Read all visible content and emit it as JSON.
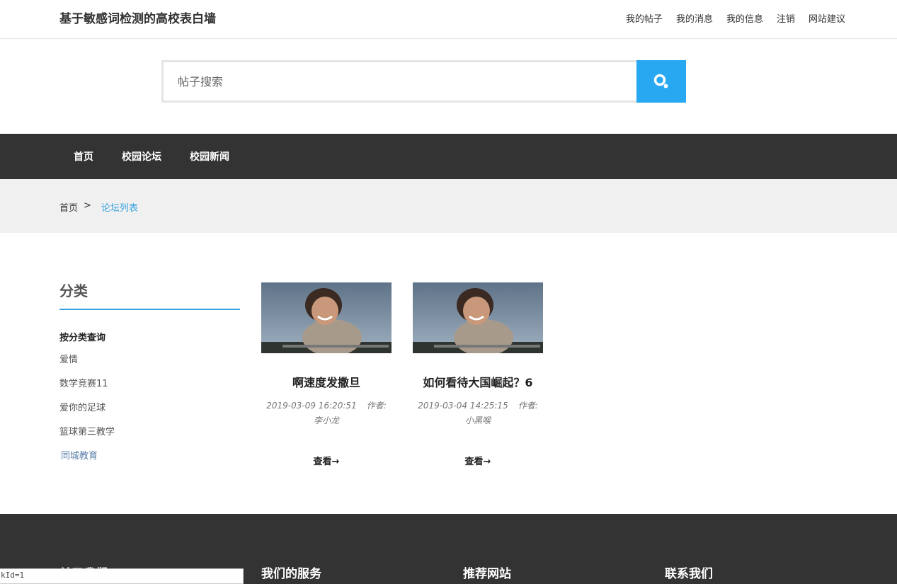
{
  "header": {
    "site_title": "基于敏感词检测的高校表白墙",
    "nav": [
      "我的帖子",
      "我的消息",
      "我的信息",
      "注销",
      "网站建议"
    ]
  },
  "search": {
    "placeholder": "帖子搜索",
    "value": "",
    "button_icon": "search-icon"
  },
  "main_nav": [
    "首页",
    "校园论坛",
    "校园新闻"
  ],
  "breadcrumb": {
    "home": "首页",
    "separator": ">",
    "current": "论坛列表"
  },
  "sidebar": {
    "title": "分类",
    "subtitle": "按分类查询",
    "items": [
      "爱情",
      "数学竞赛11",
      "爱你的足球",
      "篮球第三教学",
      "同城教育"
    ]
  },
  "posts": [
    {
      "title": "啊速度发撒旦",
      "date": "2019-03-09 16:20:51",
      "author": "作者: 李小龙",
      "link": "查看→"
    },
    {
      "title": "如何看待大国崛起？6",
      "date": "2019-03-04 14:25:15",
      "author": "作者: 小黑喉",
      "link": "查看→"
    }
  ],
  "footer": {
    "columns": [
      "关于我们",
      "我们的服务",
      "推荐网站",
      "联系我们"
    ]
  },
  "status_bar": "kId=1",
  "colors": {
    "accent": "#3ba4e0",
    "search_button": "#28a8f0",
    "nav_bg": "#333333",
    "crumb_bg": "#f0f0f0"
  }
}
